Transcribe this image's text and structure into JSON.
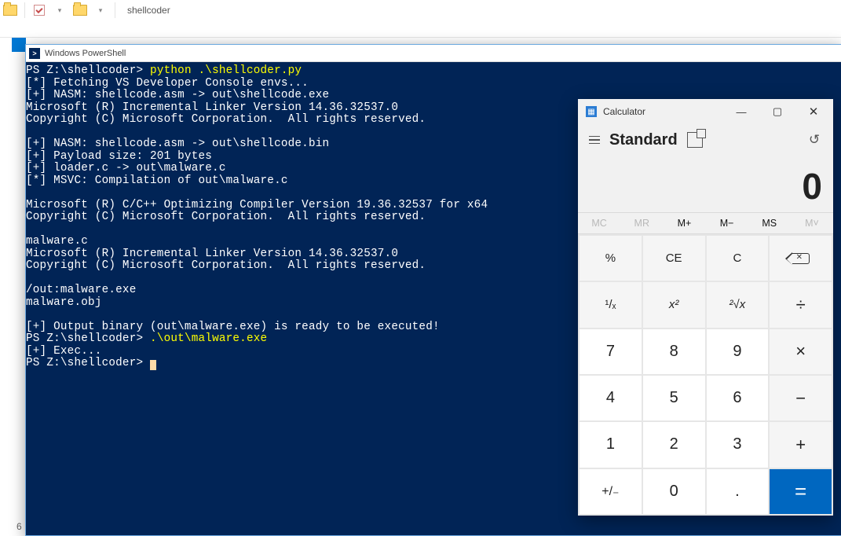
{
  "explorer": {
    "title": "shellcoder",
    "caret": "▾"
  },
  "powershell": {
    "title": "Windows PowerShell",
    "prompt": "PS Z:\\shellcoder>",
    "cmd1": "python .\\shellcoder.py",
    "lines": [
      "[*] Fetching VS Developer Console envs...",
      "[+] NASM: shellcode.asm -> out\\shellcode.exe",
      "Microsoft (R) Incremental Linker Version 14.36.32537.0",
      "Copyright (C) Microsoft Corporation.  All rights reserved.",
      "",
      "[+] NASM: shellcode.asm -> out\\shellcode.bin",
      "[+] Payload size: 201 bytes",
      "[+] loader.c -> out\\malware.c",
      "[*] MSVC: Compilation of out\\malware.c",
      "",
      "Microsoft (R) C/C++ Optimizing Compiler Version 19.36.32537 for x64",
      "Copyright (C) Microsoft Corporation.  All rights reserved.",
      "",
      "malware.c",
      "Microsoft (R) Incremental Linker Version 14.36.32537.0",
      "Copyright (C) Microsoft Corporation.  All rights reserved.",
      "",
      "/out:malware.exe",
      "malware.obj",
      "",
      "[+] Output binary (out\\malware.exe) is ready to be executed!"
    ],
    "cmd2": ".\\out\\malware.exe",
    "tail": "[+] Exec...",
    "last_prompt": "PS Z:\\shellcoder>"
  },
  "bg_char": "6",
  "calculator": {
    "title": "Calculator",
    "mode": "Standard",
    "display": "0",
    "mem": [
      "MC",
      "MR",
      "M+",
      "M−",
      "MS",
      "M˅"
    ],
    "keys": {
      "pct": "%",
      "ce": "CE",
      "c": "C",
      "inv": "¹/ₓ",
      "sq": "x²",
      "root": "²√x",
      "div": "÷",
      "n7": "7",
      "n8": "8",
      "n9": "9",
      "mul": "×",
      "n4": "4",
      "n5": "5",
      "n6": "6",
      "sub": "−",
      "n1": "1",
      "n2": "2",
      "n3": "3",
      "add": "+",
      "pm": "+/₋",
      "n0": "0",
      "dot": ".",
      "eq": "="
    },
    "win": {
      "min": "—",
      "max": "▢",
      "close": "✕"
    },
    "hist": "↺"
  }
}
